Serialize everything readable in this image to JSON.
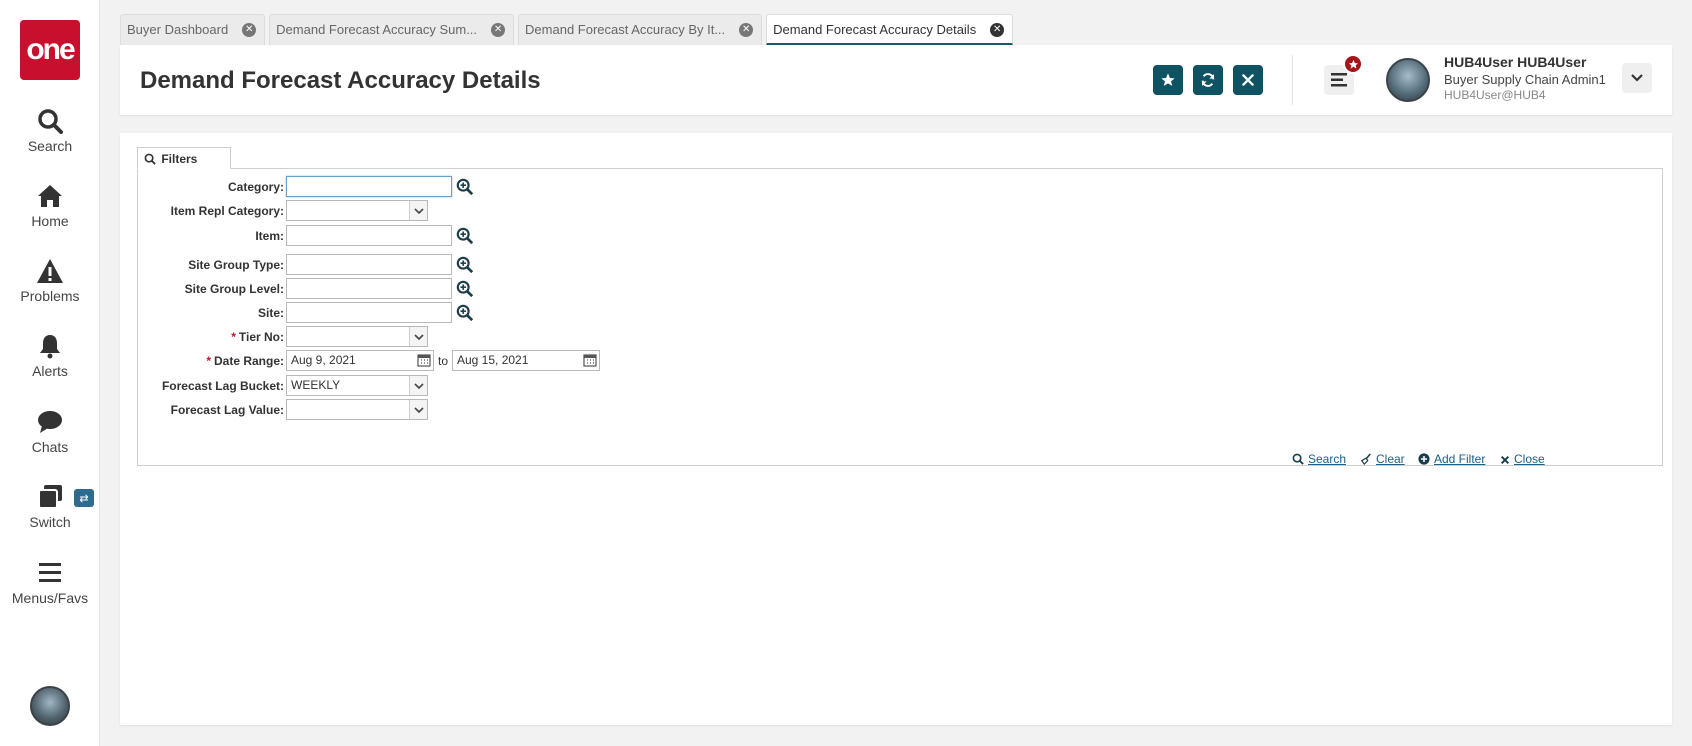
{
  "sidebar": {
    "logo": "one",
    "items": [
      {
        "label": "Search",
        "icon": "search-icon"
      },
      {
        "label": "Home",
        "icon": "home-icon"
      },
      {
        "label": "Problems",
        "icon": "warning-icon"
      },
      {
        "label": "Alerts",
        "icon": "bell-icon"
      },
      {
        "label": "Chats",
        "icon": "chat-icon"
      },
      {
        "label": "Switch",
        "icon": "switch-icon"
      },
      {
        "label": "Menus/Favs",
        "icon": "hamburger-icon"
      }
    ],
    "switch_badge": "⇄"
  },
  "tabs": [
    {
      "label": "Buyer Dashboard",
      "active": false
    },
    {
      "label": "Demand Forecast Accuracy Sum...",
      "active": false
    },
    {
      "label": "Demand Forecast Accuracy By It...",
      "active": false
    },
    {
      "label": "Demand Forecast Accuracy Details",
      "active": true
    }
  ],
  "header": {
    "title": "Demand Forecast Accuracy Details",
    "buttons": [
      "star-icon",
      "refresh-icon",
      "close-icon"
    ],
    "user": {
      "name": "HUB4User HUB4User",
      "role": "Buyer Supply Chain Admin1",
      "org": "HUB4User@HUB4"
    }
  },
  "filters": {
    "tab_label": "Filters",
    "fields": {
      "category": {
        "label": "Category:",
        "value": ""
      },
      "item_repl_category": {
        "label": "Item Repl Category:",
        "value": ""
      },
      "item": {
        "label": "Item:",
        "value": ""
      },
      "site_group_type": {
        "label": "Site Group Type:",
        "value": ""
      },
      "site_group_level": {
        "label": "Site Group Level:",
        "value": ""
      },
      "site": {
        "label": "Site:",
        "value": ""
      },
      "tier_no": {
        "label": "Tier No:",
        "value": "",
        "required": true
      },
      "date_range": {
        "label": "Date Range:",
        "from": "Aug 9, 2021",
        "to_label": "to",
        "to": "Aug 15, 2021",
        "required": true
      },
      "forecast_lag_bucket": {
        "label": "Forecast Lag Bucket:",
        "value": "WEEKLY"
      },
      "forecast_lag_value": {
        "label": "Forecast Lag Value:",
        "value": ""
      }
    },
    "required_mark": "*",
    "actions": {
      "search": "Search",
      "clear": "Clear",
      "add_filter": "Add Filter",
      "close": "Close"
    }
  },
  "colors": {
    "brand_red": "#c8102e",
    "primary_teal": "#0f5261",
    "link_blue": "#1b5f86"
  }
}
